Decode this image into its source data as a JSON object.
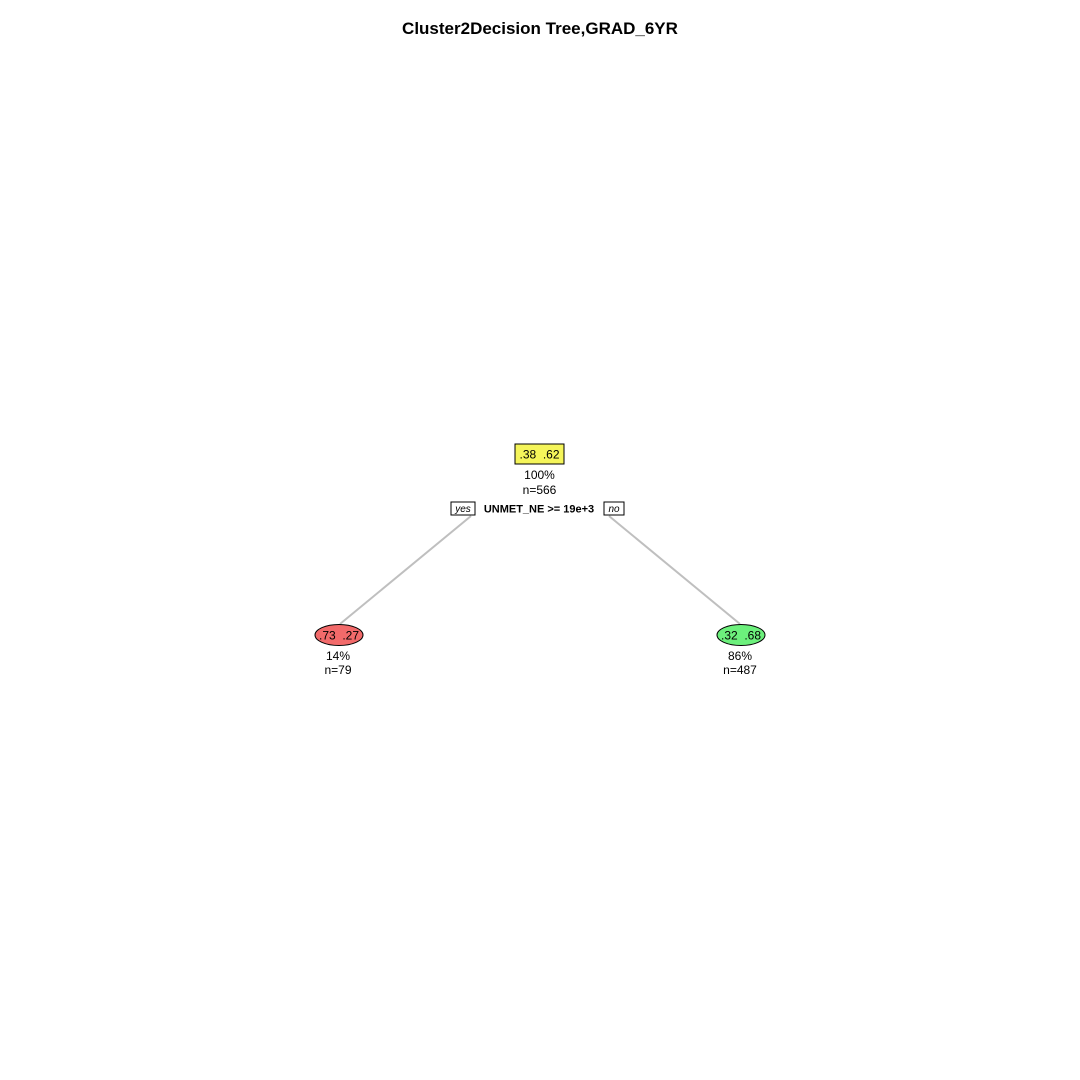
{
  "title": "Cluster2Decision Tree,GRAD_6YR",
  "tree": {
    "root": {
      "probs": ".38  .62",
      "percent": "100%",
      "n": "n=566",
      "fill": "#f5f55a"
    },
    "split": {
      "yes_label": "yes",
      "condition": "UNMET_NE >= 19e+3",
      "no_label": "no"
    },
    "left_leaf": {
      "probs": ".73  .27",
      "percent": "14%",
      "n": "n=79",
      "fill": "#f26a6a"
    },
    "right_leaf": {
      "probs": ".32  .68",
      "percent": "86%",
      "n": "n=487",
      "fill": "#6cf07c"
    },
    "edge_color": "#bfbfbf"
  }
}
